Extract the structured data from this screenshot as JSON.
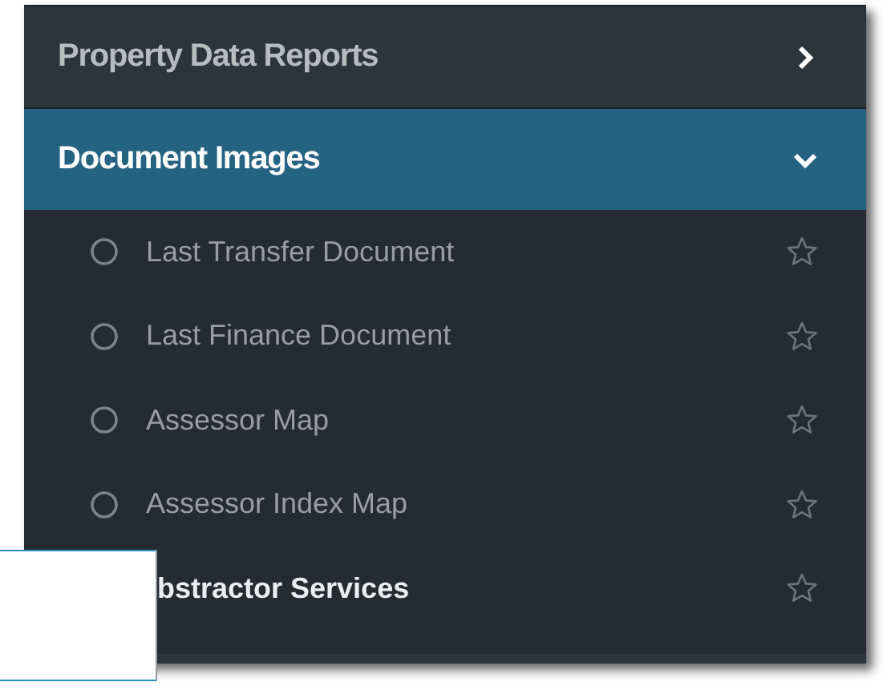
{
  "menu": {
    "sections": [
      {
        "label": "Property Data Reports",
        "expanded": false,
        "selected": false
      },
      {
        "label": "Document Images",
        "expanded": true,
        "selected": true,
        "items": [
          {
            "kind": "option",
            "label": "Last Transfer Document",
            "selected": false,
            "favorite": false
          },
          {
            "kind": "option",
            "label": "Last Finance Document",
            "selected": false,
            "favorite": false
          },
          {
            "kind": "option",
            "label": "Assessor Map",
            "selected": false,
            "favorite": false
          },
          {
            "kind": "option",
            "label": "Assessor Index Map",
            "selected": false,
            "favorite": false
          },
          {
            "kind": "heading",
            "label": "bstractor Services",
            "favorite": false
          }
        ]
      }
    ]
  }
}
